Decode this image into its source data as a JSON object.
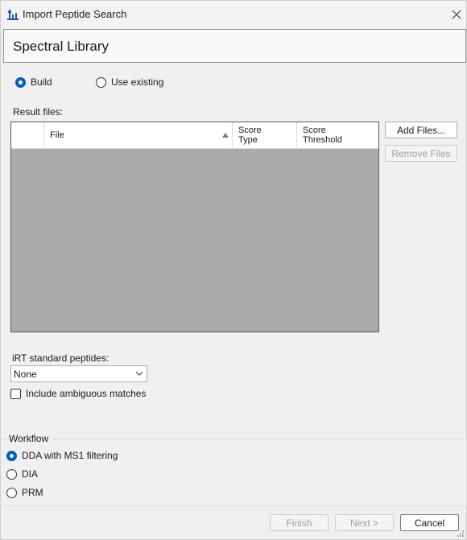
{
  "window": {
    "title": "Import Peptide Search"
  },
  "header": {
    "title": "Spectral Library"
  },
  "library_source": {
    "options": [
      {
        "label": "Build",
        "selected": true
      },
      {
        "label": "Use existing",
        "selected": false
      }
    ]
  },
  "result_files": {
    "label": "Result files:",
    "columns": [
      {
        "label": ""
      },
      {
        "label": "File",
        "sorted": "ascending"
      },
      {
        "label": "Score\nType"
      },
      {
        "label": "Score\nThreshold"
      }
    ],
    "rows": [],
    "add_button": "Add Files...",
    "remove_button": "Remove Files"
  },
  "irt": {
    "label": "iRT standard peptides:",
    "selected": "None"
  },
  "ambiguous": {
    "label": "Include ambiguous matches",
    "checked": false
  },
  "workflow": {
    "title": "Workflow",
    "options": [
      {
        "label": "DDA with MS1 filtering",
        "selected": true
      },
      {
        "label": "DIA",
        "selected": false
      },
      {
        "label": "PRM",
        "selected": false
      }
    ]
  },
  "footer": {
    "finish": "Finish",
    "next": "Next >",
    "cancel": "Cancel"
  },
  "colors": {
    "accent": "#005fb8",
    "grid_empty": "#ababab"
  }
}
